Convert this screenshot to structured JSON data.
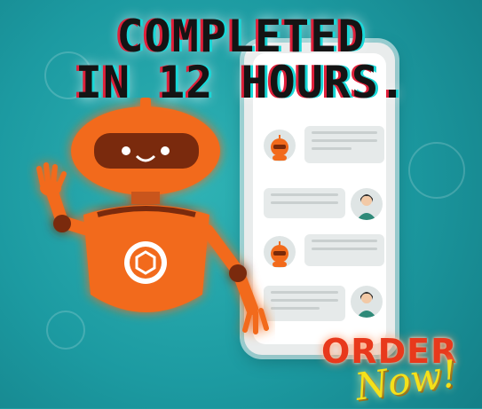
{
  "headline": {
    "line1": "COMPLETED",
    "line2": "IN 12 HOURS."
  },
  "cta": {
    "order": "ORDER",
    "now": "Now!"
  },
  "colors": {
    "background": "#1f9aa0",
    "robot": "#f26a1b",
    "order_text": "#e8391c",
    "now_text": "#f4e11a"
  },
  "icons": [
    "robot-mascot-icon",
    "chat-bot-avatar-icon",
    "user-avatar-icon",
    "hexagon-logo-icon"
  ]
}
